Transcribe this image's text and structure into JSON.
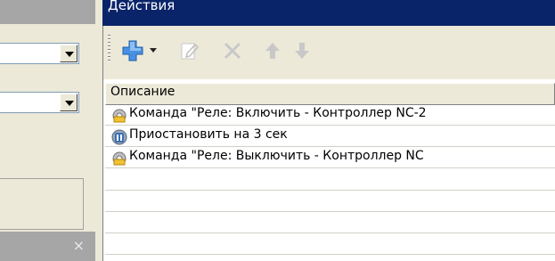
{
  "panel": {
    "title": "Действия",
    "column_header": "Описание",
    "rows": [
      {
        "icon": "command-icon",
        "text": "Команда \"Реле: Включить - Контроллер NC-2"
      },
      {
        "icon": "pause-icon",
        "text": "Приостановить на 3 сек"
      },
      {
        "icon": "command-icon",
        "text": "Команда \"Реле: Выключить - Контроллер NC"
      }
    ]
  },
  "toolbar": {
    "buttons": [
      "add-icon",
      "dropdown-arrow-icon",
      "edit-icon",
      "delete-icon",
      "move-up-icon",
      "move-down-icon"
    ]
  },
  "left": {
    "close_glyph": "×"
  },
  "colors": {
    "title_bar": "#0a246a",
    "panel_bg": "#ece9d8"
  }
}
